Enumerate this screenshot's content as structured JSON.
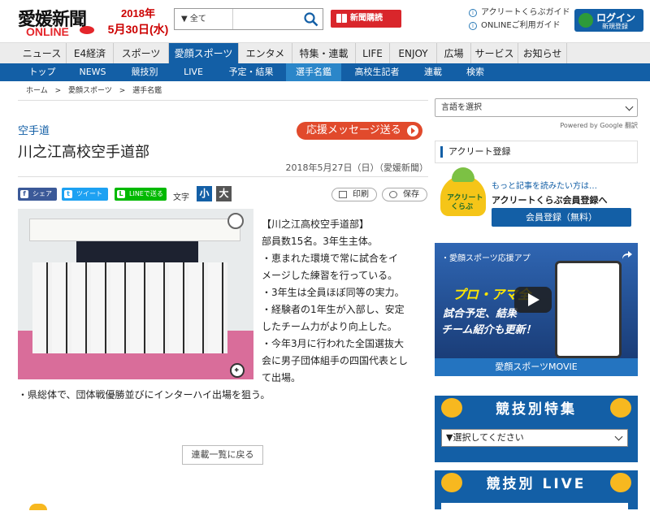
{
  "header": {
    "logo_text": "愛媛新聞",
    "logo_sub": "ONLINE",
    "date_year": "2018年",
    "date_md": "5月30日(水)",
    "search_scope": "▼ 全て",
    "subscribe_label": "新聞購読",
    "guide_links": [
      "アクリートくらぶガイド",
      "ONLINEご利用ガイド"
    ],
    "login_label": "ログイン",
    "login_sub": "新規登録"
  },
  "nav_main": [
    "ニュース",
    "E4経済",
    "スポーツ",
    "愛顔スポーツ",
    "エンタメ",
    "特集・連載",
    "LIFE",
    "ENJOY",
    "広場",
    "サービス",
    "お知らせ"
  ],
  "nav_sub": [
    "トップ",
    "NEWS",
    "競技別",
    "LIVE",
    "予定・結果",
    "選手名鑑",
    "高校生記者",
    "連載",
    "検索"
  ],
  "breadcrumb": [
    "ホーム",
    ">",
    "愛顔スポーツ",
    ">",
    "選手名鑑"
  ],
  "article": {
    "category": "空手道",
    "cheer_label": "応援メッセージ送る",
    "title": "川之江高校空手道部",
    "published": "2018年5月27日（日）（愛媛新聞）",
    "share": [
      "シェア",
      "ツイート",
      "LINEで送る"
    ],
    "font_label": "文字",
    "font_small": "小",
    "font_large": "大",
    "print_label": "印刷",
    "save_label": "保存",
    "body_lines": [
      "【川之江高校空手道部】",
      "部員数15名。3年生主体。",
      "・恵まれた環境で常に試合をイ",
      "メージした練習を行っている。",
      "・3年生は全員ほぼ同等の実力。",
      "・経験者の1年生が入部し、安定",
      "したチーム力がより向上した。",
      "・今年3月に行われた全国選抜大",
      "会に男子団体組手の四国代表とし",
      "て出場。"
    ],
    "body_last": "・県総体で、団体戦優勝並びにインターハイ出場を狙う。",
    "back_label": "連載一覧に戻る"
  },
  "sidebar": {
    "language_select": "言語を選択",
    "powered_by": "Powered by Google 翻訳",
    "acreet_heading": "アクリート登録",
    "mascot_line1": "アクリート",
    "mascot_line2": "くらぶ",
    "more_text": "もっと記事を読みたい方は…",
    "join_text": "アクリートくらぶ会員登録へ",
    "register_label": "会員登録（無料）",
    "video_title": "・愛顔スポーツ応援アプ",
    "video_line1": "プロ・アマ全",
    "video_line2": "試合予定、結果",
    "video_line3": "チーム紹介も更新！",
    "movie_label": "愛顔スポーツMOVIE",
    "feature_heading": "競技別特集",
    "feature_select": "▼選択してください",
    "live_heading": "競技別 LIVE"
  },
  "colors": {
    "brand_blue": "#135fa6",
    "accent_red": "#d9262b",
    "cheer_orange": "#e14a2c"
  }
}
